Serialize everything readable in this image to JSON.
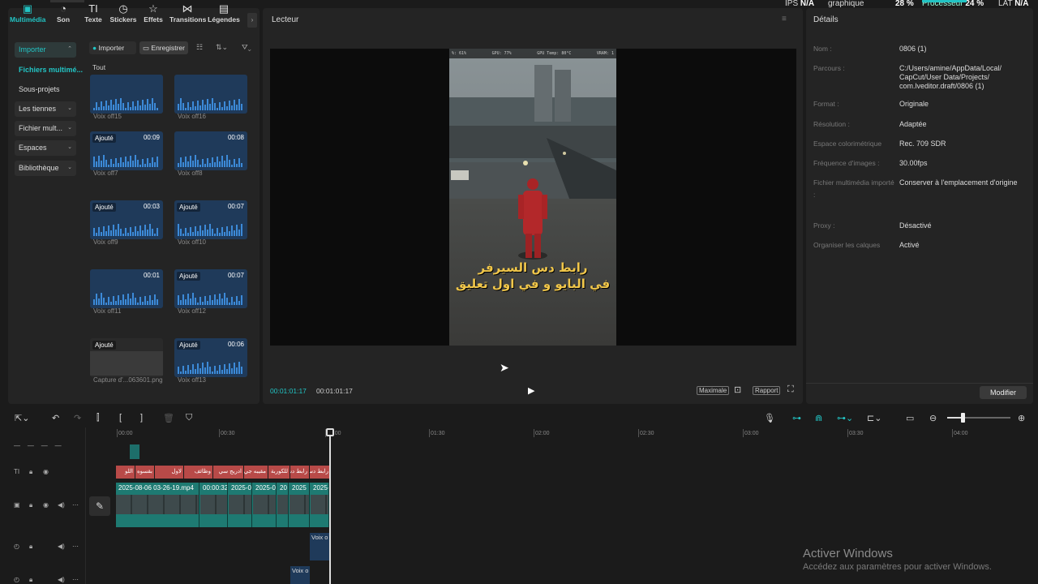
{
  "status_bar": {
    "ips_label": "IPS",
    "ips_value": "N/A",
    "graphique_label": "graphique",
    "gpu_value": "28 %",
    "processeur_label": "Processeur",
    "processeur_value": "24 %",
    "lat_label": "LAT",
    "lat_value": "N/A"
  },
  "toolbar_tabs": [
    {
      "label": "Multimédia",
      "icon": "media-icon"
    },
    {
      "label": "Son",
      "icon": "music-icon"
    },
    {
      "label": "Texte",
      "icon": "text-icon"
    },
    {
      "label": "Stickers",
      "icon": "sticker-icon"
    },
    {
      "label": "Effets",
      "icon": "effects-icon"
    },
    {
      "label": "Transitions",
      "icon": "transitions-icon"
    },
    {
      "label": "Légendes",
      "icon": "captions-icon"
    }
  ],
  "sidebar": {
    "importer": "Importer",
    "fichiers": "Fichiers multimé...",
    "sous_projets": "Sous-projets",
    "les_tiennes": "Les tiennes",
    "fichier_mult": "Fichier mult...",
    "espaces": "Espaces",
    "bibliotheque": "Bibliothèque"
  },
  "media_toolbar": {
    "import_btn": "Importer",
    "record_btn": "Enregistrer"
  },
  "media": {
    "section_label": "Tout",
    "items": [
      {
        "name": "Voix off15",
        "badge": "",
        "duration": ""
      },
      {
        "name": "Voix off16",
        "badge": "",
        "duration": ""
      },
      {
        "name": "Voix off7",
        "badge": "Ajouté",
        "duration": "00:09"
      },
      {
        "name": "Voix off8",
        "badge": "",
        "duration": "00:08"
      },
      {
        "name": "Voix off9",
        "badge": "Ajouté",
        "duration": "00:03"
      },
      {
        "name": "Voix off10",
        "badge": "Ajouté",
        "duration": "00:07"
      },
      {
        "name": "Voix off11",
        "badge": "",
        "duration": "00:01"
      },
      {
        "name": "Voix off12",
        "badge": "Ajouté",
        "duration": "00:07"
      },
      {
        "name": "Capture d'...063601.png",
        "badge": "Ajouté",
        "duration": ""
      },
      {
        "name": "Voix off13",
        "badge": "Ajouté",
        "duration": "00:06"
      }
    ]
  },
  "player": {
    "title": "Lecteur",
    "hud": [
      "%: 61%",
      "GPU: 77%",
      "GPU Temp: 80°C",
      "VRAM: 1"
    ],
    "subtitle_line1": "رابط دس السيرفر",
    "subtitle_line2": "في البايو و في اول تعليق",
    "current_time": "00:01:01:17",
    "total_time": "00:01:01:17",
    "maximale_btn": "Maximale",
    "rapport_btn": "Rapport"
  },
  "details": {
    "title": "Détails",
    "rows": [
      {
        "key": "Nom :",
        "value": "0806 (1)"
      },
      {
        "key": "Parcours :",
        "value": "C:/Users/amine/AppData/Local/ CapCut/User Data/Projects/ com.lveditor.draft/0806 (1)"
      },
      {
        "key": "Format :",
        "value": "Originale"
      },
      {
        "key": "Résolution :",
        "value": "Adaptée"
      },
      {
        "key": "Espace colorimétrique",
        "value": "Rec. 709 SDR"
      },
      {
        "key": "Fréquence d'images :",
        "value": "30.00fps"
      },
      {
        "key": "Fichier multimédia importé :",
        "value": "Conserver à l'emplacement d'origine"
      },
      {
        "key": "Proxy :",
        "value": "Désactivé"
      },
      {
        "key": "Organiser les calques",
        "value": "Activé"
      }
    ],
    "modify_btn": "Modifier"
  },
  "timeline": {
    "ruler": [
      "00:00",
      "00:30",
      "01:00",
      "01:30",
      "02:00",
      "02:30",
      "03:00",
      "03:30",
      "04:00"
    ],
    "text_clips": [
      "اللو",
      "بقسوه",
      "لاول",
      "وظائف",
      "ادريج سي",
      "مقيبه جي",
      "للكوربة",
      "رابط دس"
    ],
    "video_clips": [
      "2025-08-06 03-26-19.mp4",
      "00:00:32",
      "2025-0",
      "2025-0",
      "20",
      "2025",
      "2025-"
    ],
    "audio_clip_1": "Voix o",
    "audio_clip_2": "Voix o"
  },
  "watermark": {
    "line1": "Activer Windows",
    "line2": "Accédez aux paramètres pour activer Windows."
  }
}
